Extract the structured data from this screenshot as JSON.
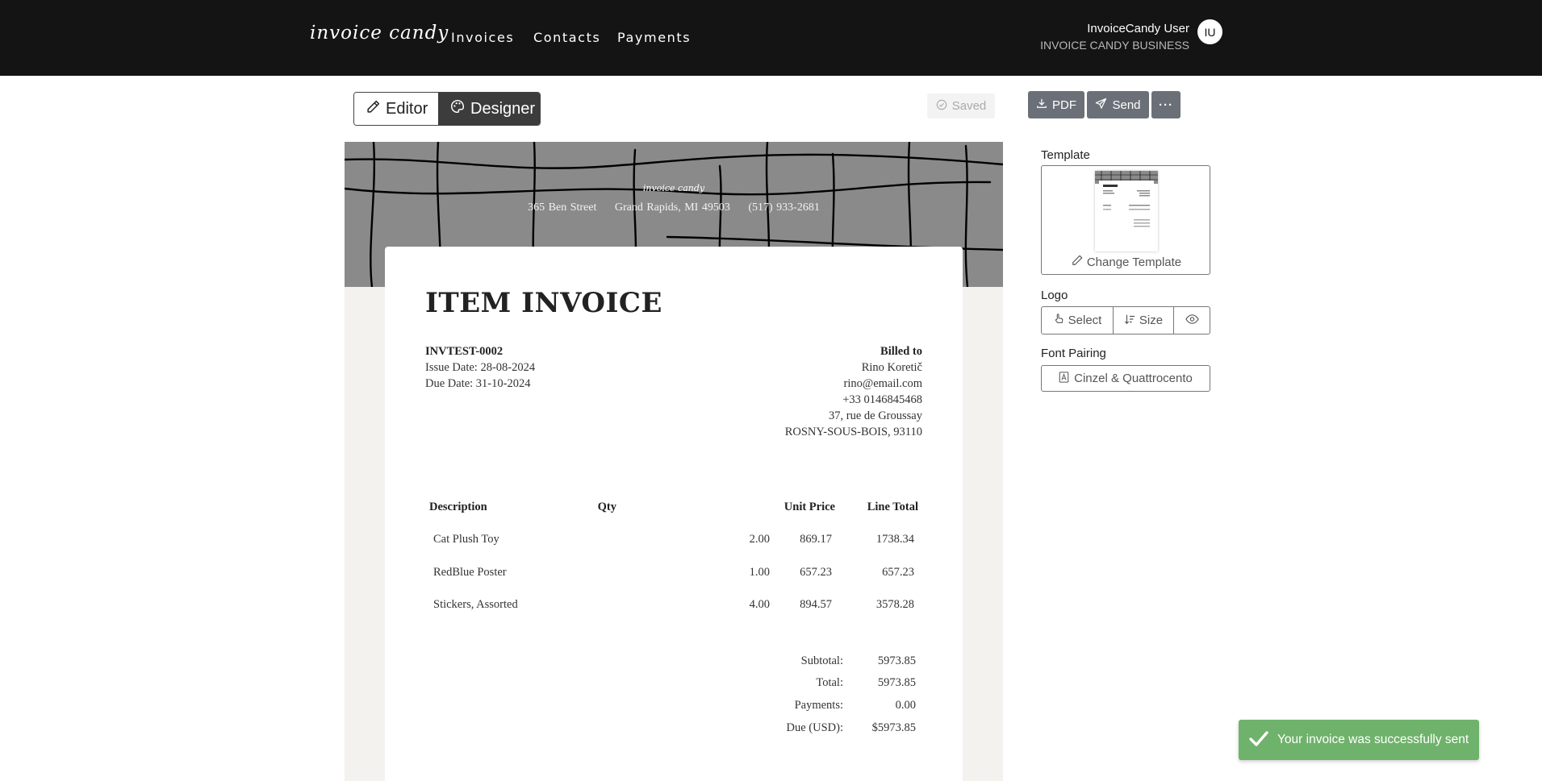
{
  "nav": {
    "brand": "invoice candy",
    "links": [
      "Invoices",
      "Contacts",
      "Payments"
    ],
    "user_name": "InvoiceCandy User",
    "business": "INVOICE CANDY BUSINESS",
    "avatar_initials": "IU"
  },
  "toolbar": {
    "editor_label": "Editor",
    "designer_label": "Designer",
    "saved_label": "Saved",
    "pdf_label": "PDF",
    "send_label": "Send",
    "more_label": "···"
  },
  "invoice": {
    "banner_logo": "invoice candy",
    "street": "365 Ben Street",
    "city": "Grand Rapids, MI 49503",
    "phone": "(517) 933-2681",
    "title": "ITEM INVOICE",
    "number": "INVTEST-0002",
    "issue_date": "Issue Date: 28-08-2024",
    "due_date": "Due Date: 31-10-2024",
    "billed_to_label": "Billed to",
    "client_name": "Rino Koretič",
    "client_email": "rino@email.com",
    "client_phone": "+33 0146845468",
    "client_street": "37, rue de Groussay",
    "client_city": "ROSNY-SOUS-BOIS, 93110",
    "columns": {
      "description": "Description",
      "qty": "Qty",
      "unit_price": "Unit Price",
      "line_total": "Line Total"
    },
    "items": [
      {
        "description": "Cat Plush Toy",
        "qty": "2.00",
        "unit_price": "869.17",
        "line_total": "1738.34"
      },
      {
        "description": "RedBlue Poster",
        "qty": "1.00",
        "unit_price": "657.23",
        "line_total": "657.23"
      },
      {
        "description": "Stickers, Assorted",
        "qty": "4.00",
        "unit_price": "894.57",
        "line_total": "3578.28"
      }
    ],
    "totals": [
      {
        "label": "Subtotal:",
        "value": "5973.85"
      },
      {
        "label": "Total:",
        "value": "5973.85"
      },
      {
        "label": "Payments:",
        "value": "0.00"
      },
      {
        "label": "Due (USD):",
        "value": "$5973.85"
      }
    ]
  },
  "panel": {
    "template_label": "Template",
    "change_template": "Change Template",
    "logo_label": "Logo",
    "select_label": "Select",
    "size_label": "Size",
    "font_pairing_label": "Font Pairing",
    "font_pairing_value": "Cinzel & Quattrocento"
  },
  "toast": {
    "message": "Your invoice was successfully sent",
    "color": "#6fb26b"
  }
}
